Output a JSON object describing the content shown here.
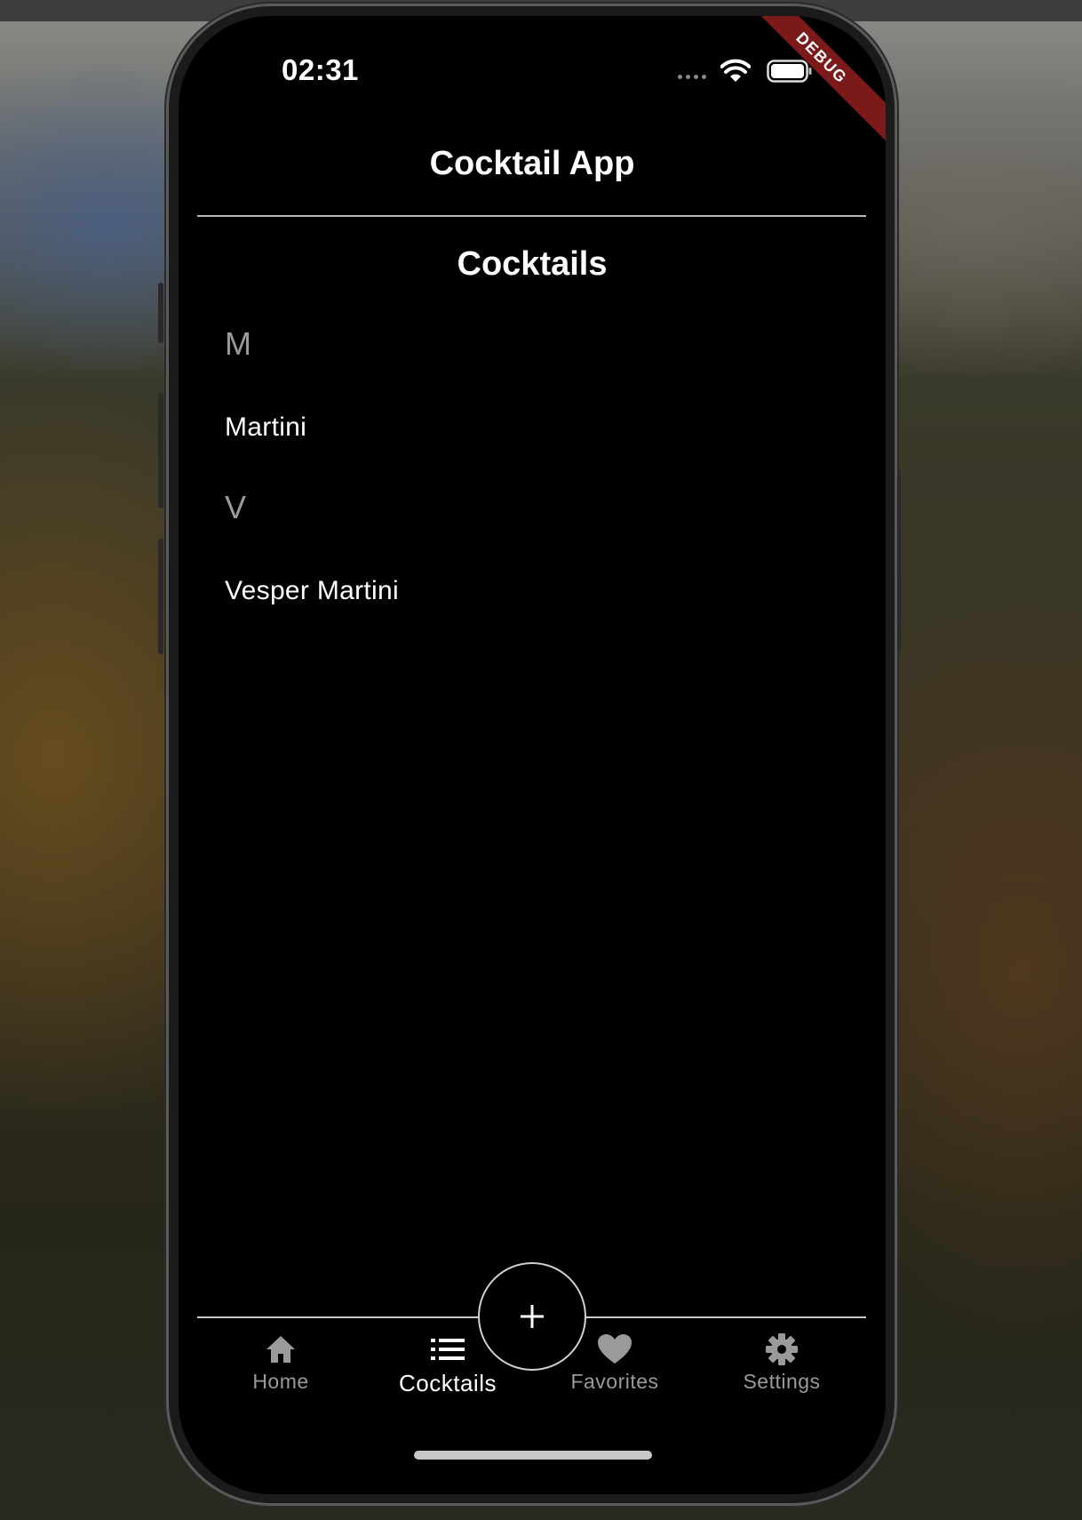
{
  "status_bar": {
    "time": "02:31",
    "icons": [
      "signal-dots-icon",
      "wifi-icon",
      "battery-icon"
    ]
  },
  "debug_banner": "DEBUG",
  "app_bar": {
    "title": "Cocktail App"
  },
  "page": {
    "title": "Cocktails",
    "sections": [
      {
        "letter": "M",
        "items": [
          "Martini"
        ]
      },
      {
        "letter": "V",
        "items": [
          "Vesper Martini"
        ]
      }
    ]
  },
  "fab": {
    "icon": "plus-icon"
  },
  "bottom_nav": {
    "items": [
      {
        "label": "Home",
        "icon": "home-icon",
        "active": false
      },
      {
        "label": "Cocktails",
        "icon": "list-icon",
        "active": true
      },
      {
        "label": "Favorites",
        "icon": "heart-icon",
        "active": false
      },
      {
        "label": "Settings",
        "icon": "gear-icon",
        "active": false
      }
    ]
  },
  "colors": {
    "screen_background": "#000000",
    "text_primary": "#ffffff",
    "text_secondary": "#9a9a9a",
    "debug_banner": "#7a1a1a",
    "divider": "#b8b8b8"
  }
}
